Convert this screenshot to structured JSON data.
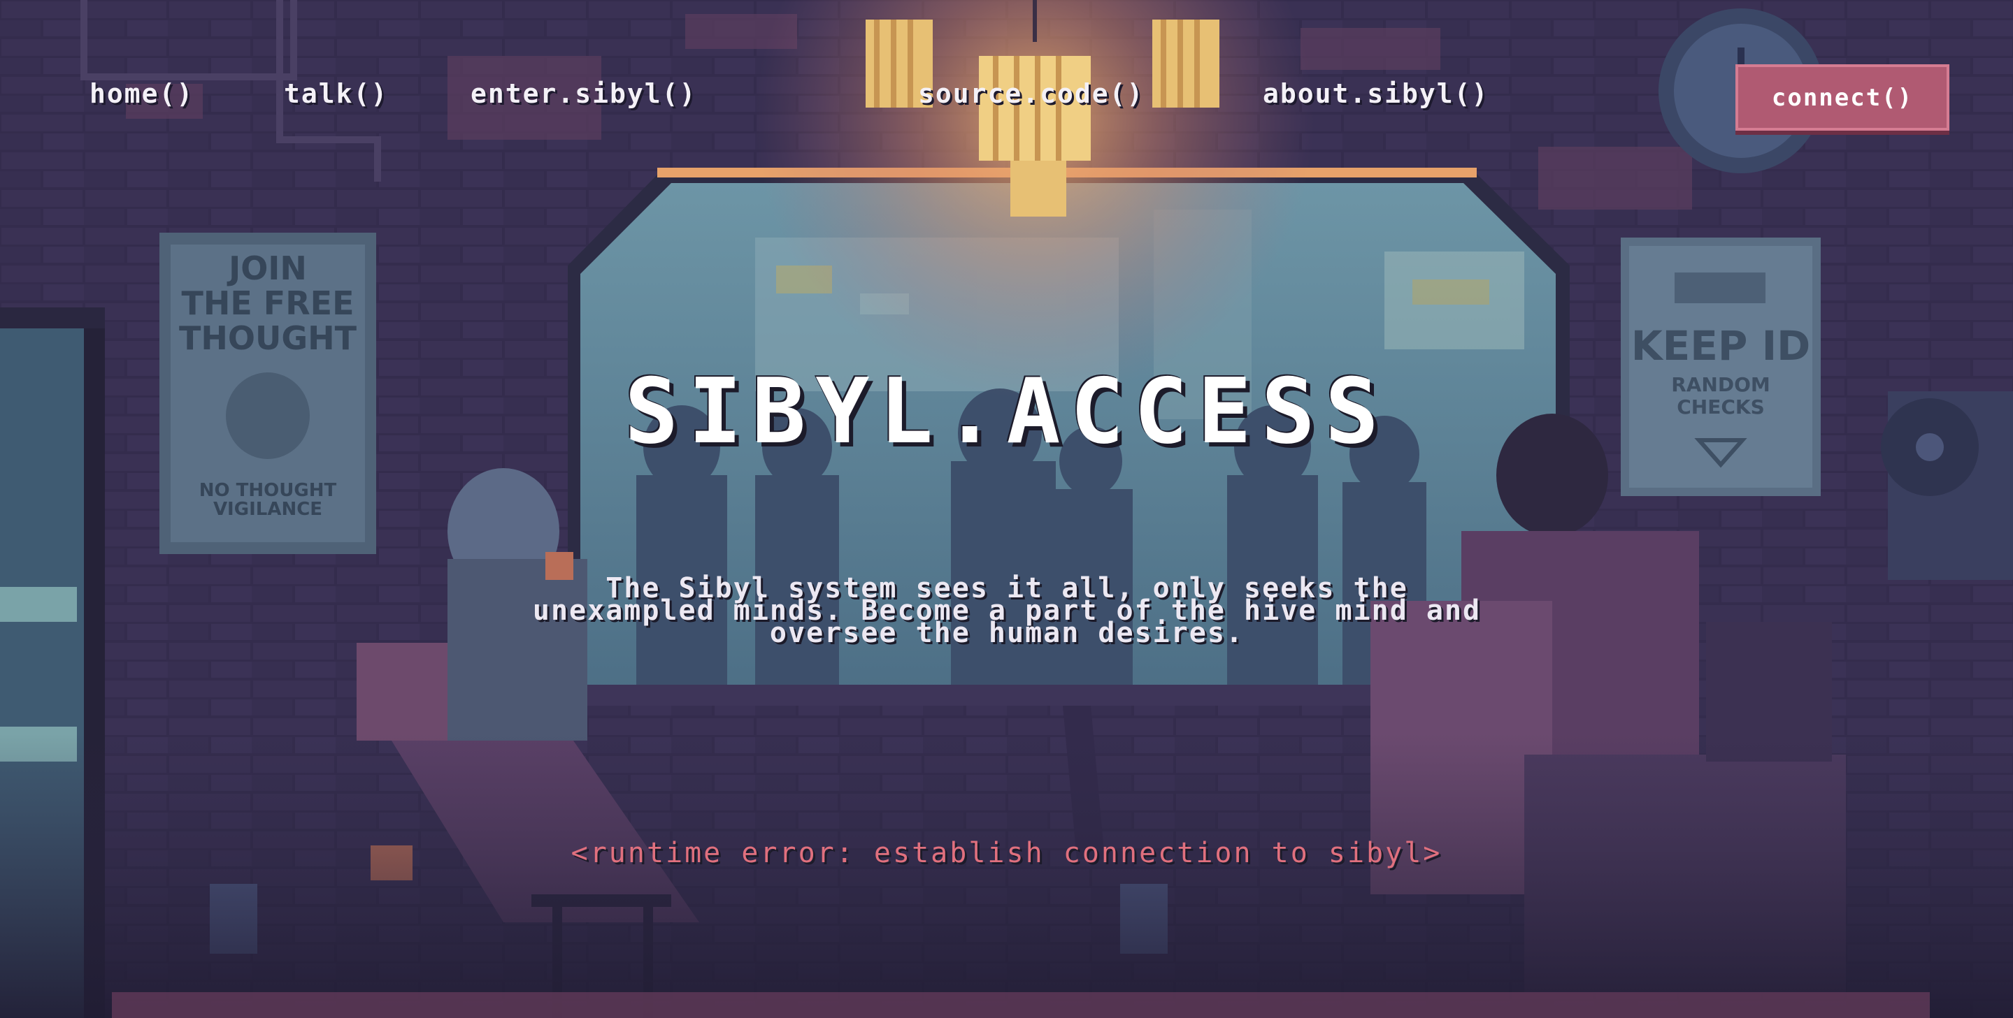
{
  "nav": {
    "items": [
      "home()",
      "talk()",
      "enter.sibyl()",
      "source.code()",
      "about.sibyl()"
    ],
    "connect_label": "connect()"
  },
  "hero": {
    "title": "SIBYL.ACCESS",
    "tagline_lines": [
      "The Sibyl system sees it all, only seeks the",
      "unexampled minds. Become a part of the hive mind and",
      "oversee the human desires."
    ]
  },
  "status": {
    "error": "<runtime error: establish connection to sibyl>"
  },
  "scene": {
    "poster_left": [
      "JOIN",
      "THE FREE",
      "THOUGHT",
      "NO THOUGHT",
      "VIGILANCE"
    ],
    "poster_right": [
      "KEEP ID",
      "RANDOM",
      "CHECKS"
    ]
  },
  "colors": {
    "accent": "#b05a72",
    "error": "#e0707e",
    "text": "#f4f1f7",
    "background": "#2f2a45"
  }
}
